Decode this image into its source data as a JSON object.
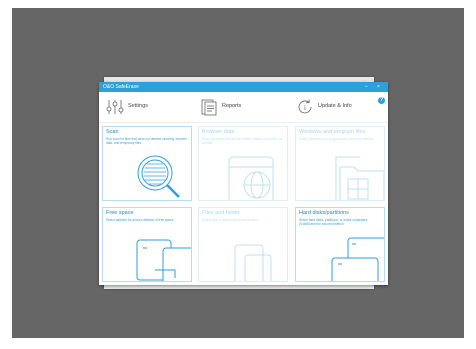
{
  "window": {
    "title": "O&O SafeErase",
    "minimize_glyph": "–",
    "close_glyph": "×"
  },
  "toolbar": {
    "settings_label": "Settings",
    "reports_label": "Reports",
    "update_label": "Update & Info",
    "help_glyph": "?"
  },
  "tiles": [
    {
      "title": "Scan",
      "desc": "Run scan for files that were not deleted securely, browser data, and temporary files",
      "enabled": true,
      "icon": "magnifier-document-icon"
    },
    {
      "title": "Browser data",
      "desc": "Select browsers that will be deleted history and cache for deletion",
      "enabled": false,
      "icon": "globe-window-icon"
    },
    {
      "title": "Windows and program files",
      "desc": "Select Windows and program files for secure deletion",
      "enabled": false,
      "icon": "windows-folder-icon"
    },
    {
      "title": "Free space",
      "desc": "Select partition for secure deletion of free space",
      "enabled": true,
      "icon": "drive-stack-icon"
    },
    {
      "title": "Files and folder",
      "desc": "Select files or folders for secure deletion",
      "enabled": false,
      "icon": "folder-icon"
    },
    {
      "title": "Hard disks/partitions",
      "desc": "Select hard disks, partitions, or entire computers (SolidErase) for secure deletion",
      "enabled": true,
      "icon": "hard-disk-icon"
    }
  ],
  "colors": {
    "accent": "#2d9fd9",
    "desktop": "#666666",
    "tile_border": "#b9dbf0"
  }
}
